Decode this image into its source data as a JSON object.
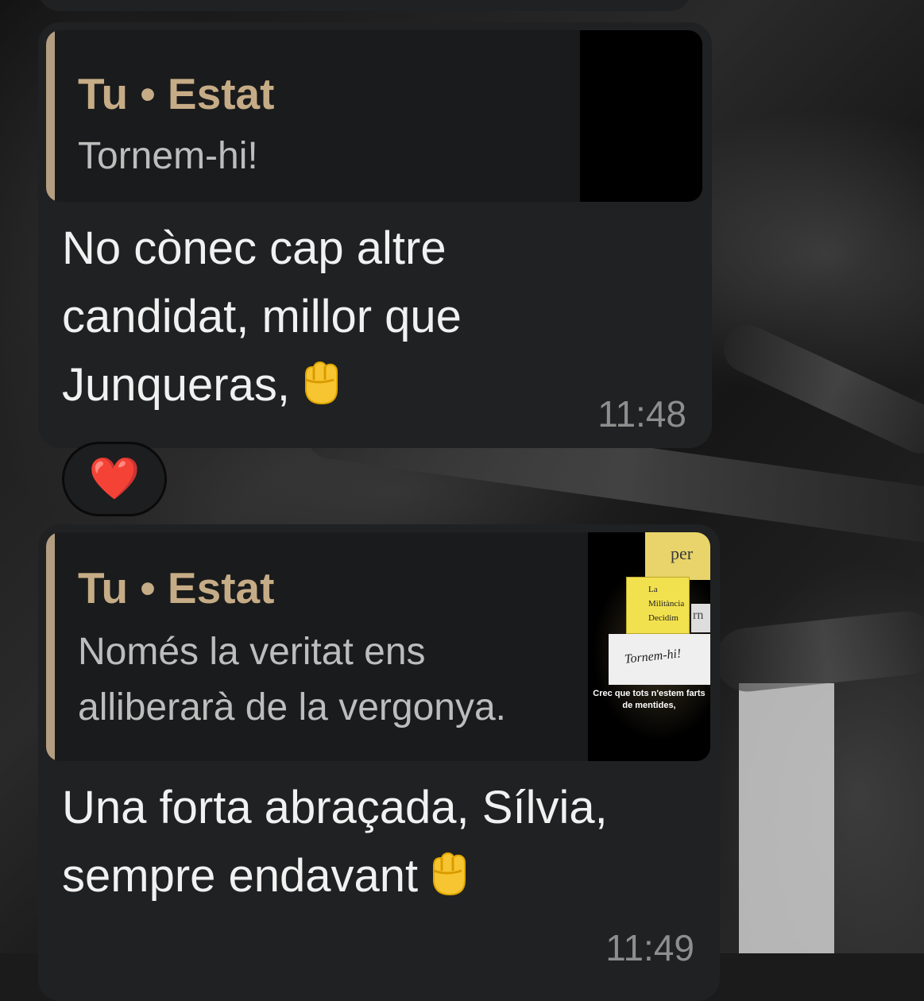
{
  "messages": [
    {
      "quote": {
        "sender": "Tu • Estat",
        "lines": [
          "Tornem-hi!"
        ]
      },
      "text_lines": [
        "No cònec cap altre",
        "candidat, millor que",
        "Junqueras,"
      ],
      "emoji": "raised-fist",
      "time": "11:48",
      "reaction": "❤️"
    },
    {
      "quote": {
        "sender": "Tu • Estat",
        "lines": [
          "Només la veritat ens",
          "alliberarà de la vergonya."
        ],
        "thumbnail": {
          "words": [
            "per",
            "La",
            "Militància",
            "Decidim",
            "rn",
            "Tornem-hi!"
          ],
          "caption": "Crec que tots n'estem farts de mentides,"
        }
      },
      "text_lines": [
        "Una forta abraçada, Sílvia,",
        "sempre endavant"
      ],
      "emoji": "raised-fist",
      "time": "11:49"
    }
  ]
}
